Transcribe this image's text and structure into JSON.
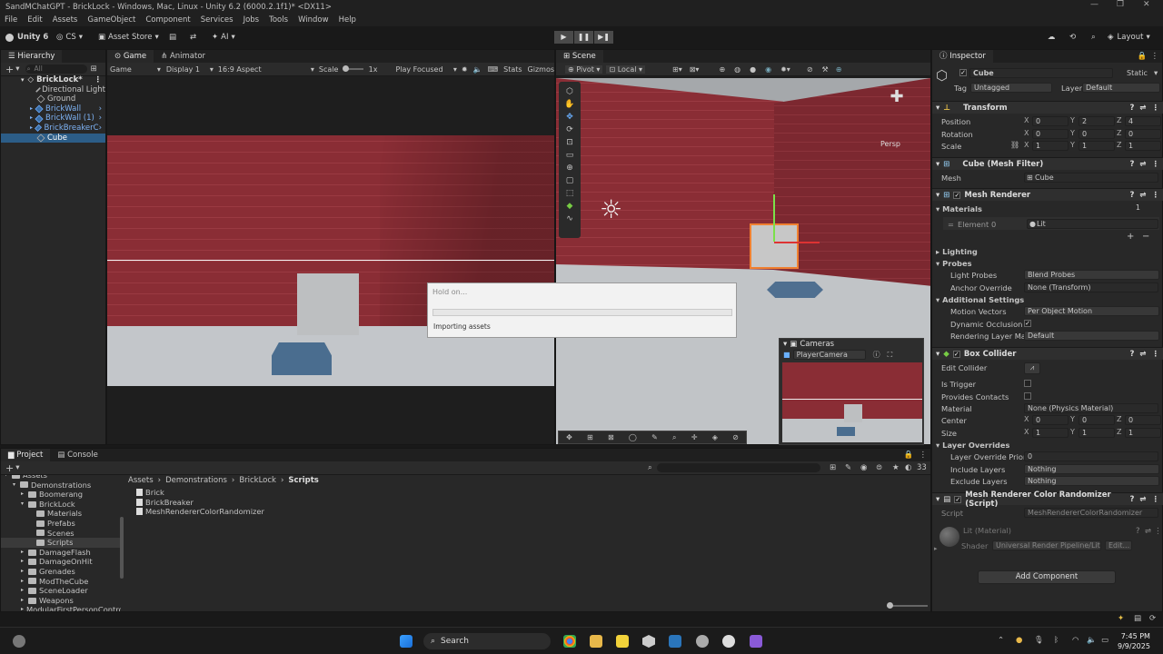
{
  "window": {
    "title": "SandMChatGPT - BrickLock - Windows, Mac, Linux - Unity 6.2 (6000.2.1f1)* <DX11>"
  },
  "menu": [
    "File",
    "Edit",
    "Assets",
    "GameObject",
    "Component",
    "Services",
    "Jobs",
    "Tools",
    "Window",
    "Help"
  ],
  "toolbar": {
    "account": "Unity 6",
    "cs": "CS",
    "asset_store": "Asset Store",
    "ai": "AI",
    "layout": "Layout"
  },
  "hierarchy": {
    "tab": "Hierarchy",
    "search_placeholder": "All",
    "scene": "BrickLock*",
    "items": [
      "Directional Light",
      "Ground",
      "BrickWall",
      "BrickWall (1)",
      "BrickBreakerC",
      "Cube"
    ]
  },
  "game": {
    "tab_game": "Game",
    "tab_animator": "Animator",
    "mode": "Game",
    "display": "Display 1",
    "aspect": "16:9 Aspect",
    "scale_label": "Scale",
    "scale_value": "1x",
    "play_focused": "Play Focused",
    "stats": "Stats",
    "gizmos": "Gizmos"
  },
  "scene": {
    "tab": "Scene",
    "pivot": "Pivot",
    "local": "Local",
    "persp": "Persp",
    "cameras_title": "Cameras",
    "camera_selected": "PlayerCamera"
  },
  "dialog": {
    "title": "Hold on...",
    "message": "Importing assets",
    "progress": 0
  },
  "inspector": {
    "tab": "Inspector",
    "object_name": "Cube",
    "static_label": "Static",
    "tag_label": "Tag",
    "tag_value": "Untagged",
    "layer_label": "Layer",
    "layer_value": "Default",
    "transform": {
      "title": "Transform",
      "rows": [
        {
          "label": "Position",
          "x": "0",
          "y": "2",
          "z": "4"
        },
        {
          "label": "Rotation",
          "x": "0",
          "y": "0",
          "z": "0"
        },
        {
          "label": "Scale",
          "x": "1",
          "y": "1",
          "z": "1"
        }
      ]
    },
    "mesh_filter": {
      "title": "Cube (Mesh Filter)",
      "mesh_label": "Mesh",
      "mesh_value": "Cube"
    },
    "mesh_renderer": {
      "title": "Mesh Renderer",
      "materials_label": "Materials",
      "materials_count": "1",
      "element_label": "Element 0",
      "element_value": "Lit",
      "lighting": "Lighting",
      "probes": "Probes",
      "light_probes_label": "Light Probes",
      "light_probes_value": "Blend Probes",
      "anchor_label": "Anchor Override",
      "anchor_value": "None (Transform)",
      "additional": "Additional Settings",
      "motion_label": "Motion Vectors",
      "motion_value": "Per Object Motion",
      "dynamic_label": "Dynamic Occlusion",
      "rendering_label": "Rendering Layer Mas",
      "rendering_value": "Default"
    },
    "box_collider": {
      "title": "Box Collider",
      "edit_label": "Edit Collider",
      "trigger_label": "Is Trigger",
      "contacts_label": "Provides Contacts",
      "material_label": "Material",
      "material_value": "None (Physics Material)",
      "center_label": "Center",
      "center": {
        "x": "0",
        "y": "0",
        "z": "0"
      },
      "size_label": "Size",
      "size": {
        "x": "1",
        "y": "1",
        "z": "1"
      },
      "layer_overrides": "Layer Overrides",
      "priority_label": "Layer Override Priori",
      "priority_value": "0",
      "include_label": "Include Layers",
      "include_value": "Nothing",
      "exclude_label": "Exclude Layers",
      "exclude_value": "Nothing"
    },
    "script": {
      "title": "Mesh Renderer Color Randomizer (Script)",
      "script_label": "Script",
      "script_value": "MeshRendererColorRandomizer"
    },
    "material": {
      "name": "Lit (Material)",
      "shader_label": "Shader",
      "shader_value": "Universal Render Pipeline/Lit",
      "edit": "Edit..."
    },
    "add_component": "Add Component"
  },
  "project": {
    "tab_project": "Project",
    "tab_console": "Console",
    "tree": [
      "Assets",
      "Demonstrations",
      "Boomerang",
      "BrickLock",
      "Materials",
      "Prefabs",
      "Scenes",
      "Scripts",
      "DamageFlash",
      "DamageOnHit",
      "Grenades",
      "ModTheCube",
      "SceneLoader",
      "Weapons",
      "ModularFirstPersonContro"
    ],
    "breadcrumb": [
      "Assets",
      "Demonstrations",
      "BrickLock",
      "Scripts"
    ],
    "files": [
      "Brick",
      "BrickBreaker",
      "MeshRendererColorRandomizer"
    ],
    "count": "33"
  },
  "taskbar": {
    "search": "Search",
    "time": "7:45 PM",
    "date": "9/9/2025"
  },
  "colors": {
    "accent": "#4d7ecb",
    "brick": "#8c2e36",
    "selected": "#2c5d87"
  }
}
